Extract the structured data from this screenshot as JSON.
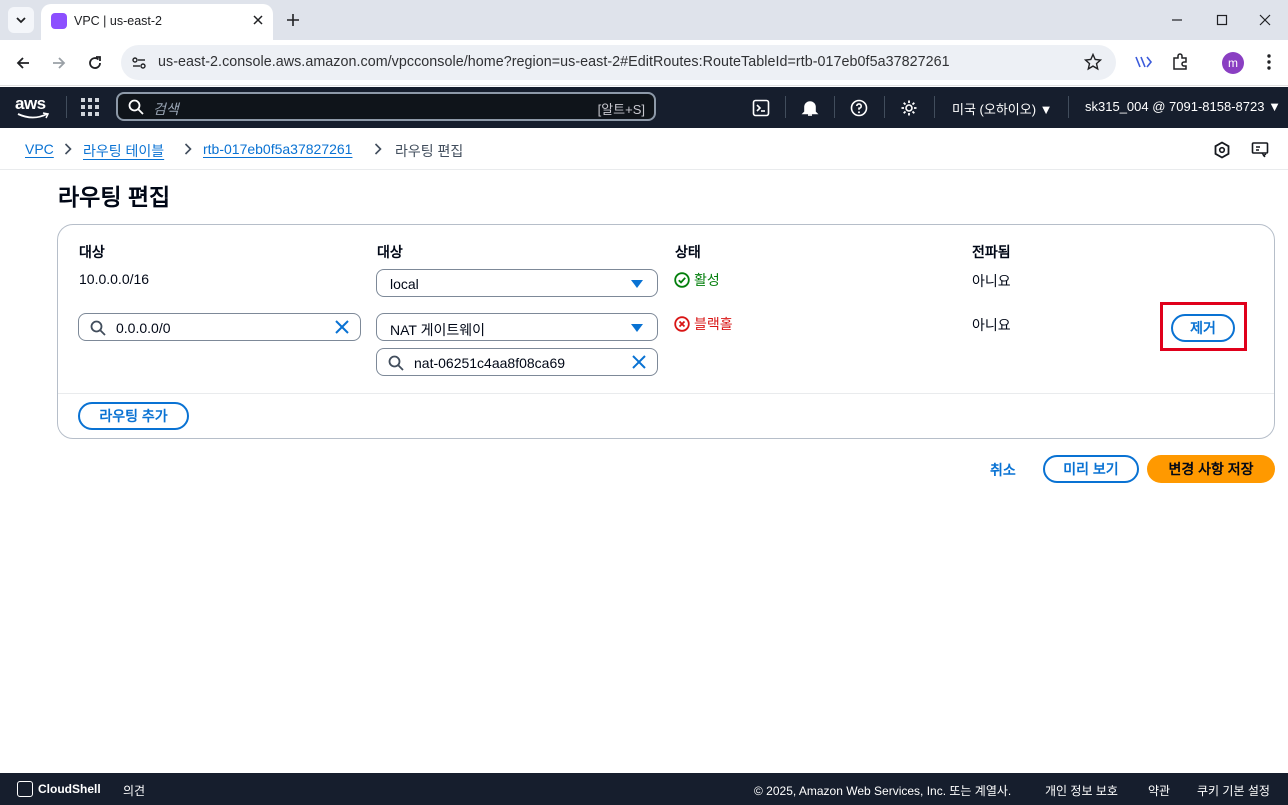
{
  "browser": {
    "tab_title": "VPC | us-east-2",
    "url": "us-east-2.console.aws.amazon.com/vpcconsole/home?region=us-east-2#EditRoutes:RouteTableId=rtb-017eb0f5a37827261",
    "profile_initial": "m"
  },
  "aws_header": {
    "logo_text": "aws",
    "search_placeholder": "검색",
    "search_shortcut": "[알트+S]",
    "region": "미국 (오하이오)",
    "account": "sk315_004 @ 7091-8158-8723"
  },
  "breadcrumb": {
    "items": [
      "VPC",
      "라우팅 테이블",
      "rtb-017eb0f5a37827261"
    ],
    "current": "라우팅 편집"
  },
  "page": {
    "title": "라우팅 편집"
  },
  "routes_table": {
    "headers": [
      "대상",
      "대상",
      "상태",
      "전파됨"
    ],
    "rows": [
      {
        "destination": "10.0.0.0/16",
        "target": "local",
        "target_id": "",
        "status": "활성",
        "propagated": "아니요"
      },
      {
        "destination": "0.0.0.0/0",
        "target": "NAT 게이트웨이",
        "target_id": "nat-06251c4aa8f08ca69",
        "status": "블랙홀",
        "propagated": "아니요",
        "remove_label": "제거"
      }
    ],
    "add_route_label": "라우팅 추가"
  },
  "actions": {
    "cancel": "취소",
    "preview": "미리 보기",
    "save": "변경 사항 저장"
  },
  "footer": {
    "cloudshell": "CloudShell",
    "feedback": "의견",
    "copyright": "© 2025, Amazon Web Services, Inc. 또는 계열사.",
    "privacy": "개인 정보 보호",
    "terms": "약관",
    "cookies": "쿠키 기본 설정"
  },
  "colors": {
    "aws_nav": "#161e2d",
    "link": "#0972d3",
    "primary_button": "#ff9900",
    "status_ok": "#037f0c",
    "status_error": "#d91515",
    "highlight": "#e0001b"
  },
  "icons": [
    "chevron-down-icon",
    "vpc-favicon",
    "close-icon",
    "plus-icon",
    "minimize-icon",
    "maximize-icon",
    "back-icon",
    "forward-icon",
    "reload-icon",
    "site-info-icon",
    "star-icon",
    "extension-icon",
    "puzzle-icon",
    "grid-icon",
    "search-icon",
    "cloudshell-icon",
    "bell-icon",
    "help-icon",
    "gear-icon",
    "check-circle-icon",
    "error-circle-icon",
    "caret-down-icon",
    "clear-icon"
  ]
}
